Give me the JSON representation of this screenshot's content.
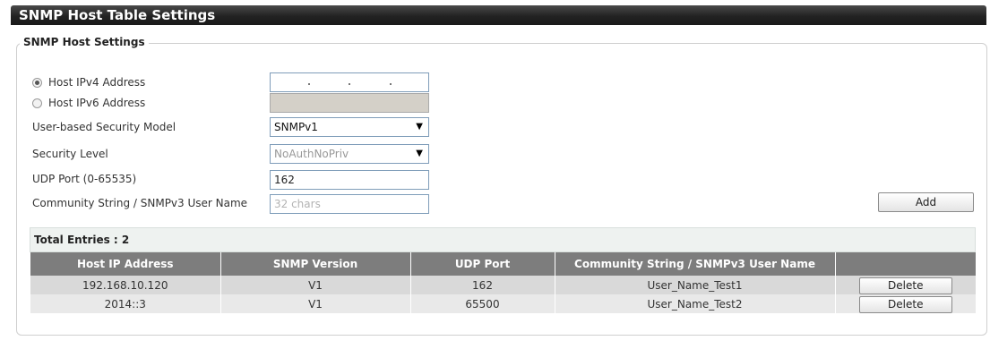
{
  "page": {
    "title": "SNMP Host Table Settings"
  },
  "form": {
    "legend": "SNMP Host Settings",
    "ipv4_label": "Host IPv4 Address",
    "ipv6_label": "Host IPv6 Address",
    "usm_label": "User-based Security Model",
    "usm_value": "SNMPv1",
    "security_label": "Security Level",
    "security_value": "NoAuthNoPriv",
    "udp_label": "UDP Port (0-65535)",
    "udp_value": "162",
    "community_label": "Community String / SNMPv3 User Name",
    "community_placeholder": "32 chars",
    "add_button": "Add",
    "selected_ip_type": "IPv4"
  },
  "table": {
    "total_label": "Total Entries : 2",
    "headers": [
      "Host IP Address",
      "SNMP Version",
      "UDP Port",
      "Community String / SNMPv3 User Name",
      ""
    ],
    "delete_label": "Delete",
    "rows": [
      {
        "host": "192.168.10.120",
        "version": "V1",
        "port": "162",
        "community": "User_Name_Test1"
      },
      {
        "host": "2014::3",
        "version": "V1",
        "port": "65500",
        "community": "User_Name_Test2"
      }
    ]
  }
}
